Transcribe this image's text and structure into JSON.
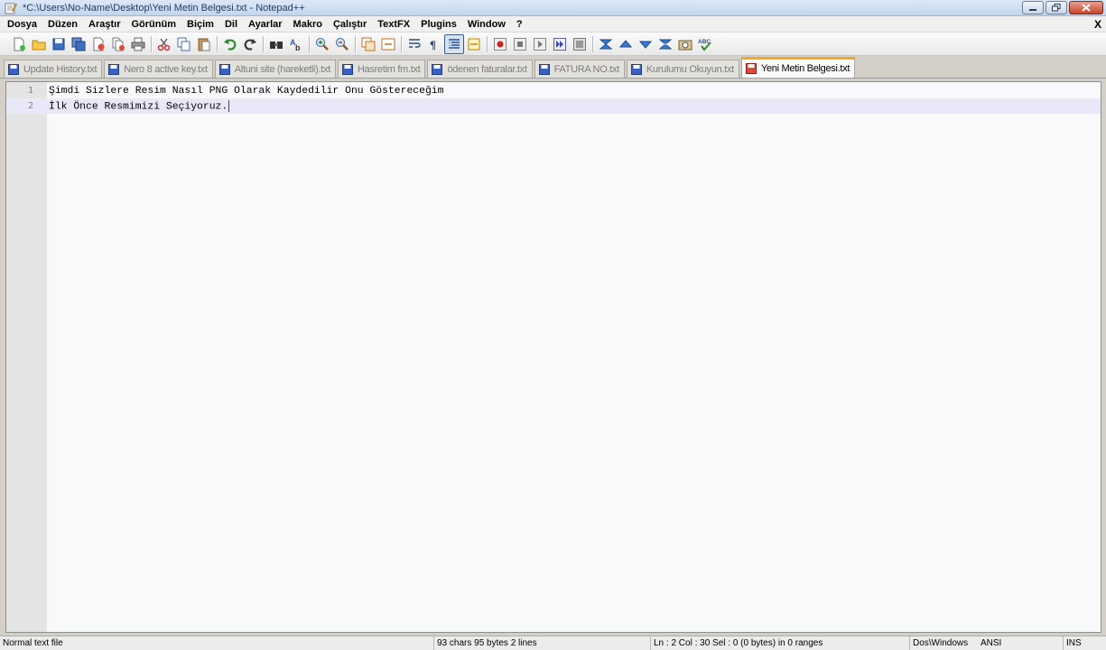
{
  "window": {
    "title": "*C:\\Users\\No-Name\\Desktop\\Yeni Metin Belgesi.txt - Notepad++"
  },
  "menu": {
    "items": [
      "Dosya",
      "Düzen",
      "Araştır",
      "Görünüm",
      "Biçim",
      "Dil",
      "Ayarlar",
      "Makro",
      "Çalıştır",
      "TextFX",
      "Plugins",
      "Window",
      "?"
    ],
    "close": "X"
  },
  "toolbar": {
    "icons": [
      "new-file-icon",
      "open-file-icon",
      "save-icon",
      "save-all-icon",
      "close-icon",
      "close-all-icon",
      "print-icon",
      "cut-icon",
      "copy-icon",
      "paste-icon",
      "undo-icon",
      "redo-icon",
      "find-icon",
      "replace-icon",
      "zoom-in-icon",
      "zoom-out-icon",
      "sync-vertical-icon",
      "sync-horizontal-icon",
      "word-wrap-icon",
      "show-all-chars-icon",
      "indent-guide-icon",
      "fold-icon",
      "record-macro-icon",
      "stop-macro-icon",
      "play-macro-icon",
      "run-macro-multiple-icon",
      "save-macro-icon",
      "trim-icon",
      "up-arrow-icon",
      "down-arrow-icon",
      "bookmark-icon",
      "monitor-icon",
      "spell-check-icon"
    ]
  },
  "tabs": [
    {
      "label": "Update History.txt",
      "active": false
    },
    {
      "label": "Nero 8 active key.txt",
      "active": false
    },
    {
      "label": "Altuni site (hareketli).txt",
      "active": false
    },
    {
      "label": "Hasretim fm.txt",
      "active": false
    },
    {
      "label": "ödenen faturalar.txt",
      "active": false
    },
    {
      "label": "FATURA NO.txt",
      "active": false
    },
    {
      "label": "Kurulumu Okuyun.txt",
      "active": false
    },
    {
      "label": "Yeni Metin Belgesi.txt",
      "active": true
    }
  ],
  "editor": {
    "lines": [
      {
        "number": "1",
        "text": "Şimdi Sizlere Resim Nasıl PNG Olarak Kaydedilir Onu Göstereceğim"
      },
      {
        "number": "2",
        "text": "İlk Önce Resmimizi Seçiyoruz."
      }
    ],
    "current_line": 2
  },
  "status": {
    "file_type": "Normal text file",
    "length": "93 chars   95 bytes   2 lines",
    "position": "Ln : 2    Col : 30    Sel : 0 (0 bytes) in 0 ranges",
    "eol": "Dos\\Windows",
    "encoding": "ANSI",
    "mode": "INS"
  },
  "colors": {
    "active_tab_accent": "#f5a623",
    "caret": "#8000ff",
    "current_line": "#e8e8f8"
  }
}
